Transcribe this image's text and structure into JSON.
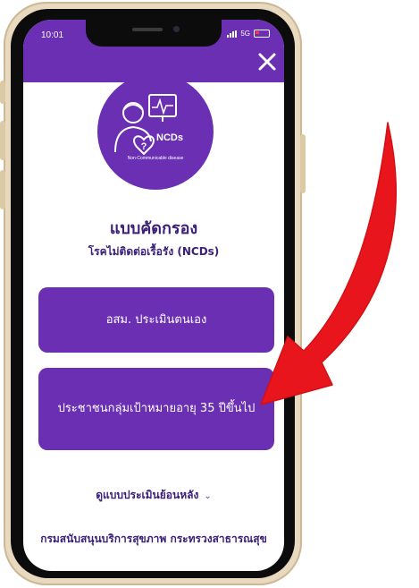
{
  "status_bar": {
    "time": "10:01",
    "network": "5G"
  },
  "logo": {
    "badge": "NCDs",
    "caption": "Non-Communicable disease",
    "icon": "person-heart-monitor-icon"
  },
  "screening": {
    "title": "แบบคัดกรอง",
    "subtitle": "โรคไม่ติดต่อเรื้อรัง (NCDs)"
  },
  "buttons": {
    "self_assessment": "อสม. ประเมินตนเอง",
    "target_group": "ประชาชนกลุ่มเป้าหมายอายุ 35 ปีขึ้นไป"
  },
  "history": {
    "label": "ดูแบบประเมินย้อนหลัง",
    "icon": "chevron-down-icon"
  },
  "footer": {
    "text": "กรมสนับสนุนบริการสุขภาพ กระทรวงสาธารณสุข"
  },
  "colors": {
    "brand_purple": "#6a2fb3",
    "text_purple": "#3a1e78",
    "arrow_red": "#e8161c",
    "frame_gold": "#e8d9bf"
  }
}
